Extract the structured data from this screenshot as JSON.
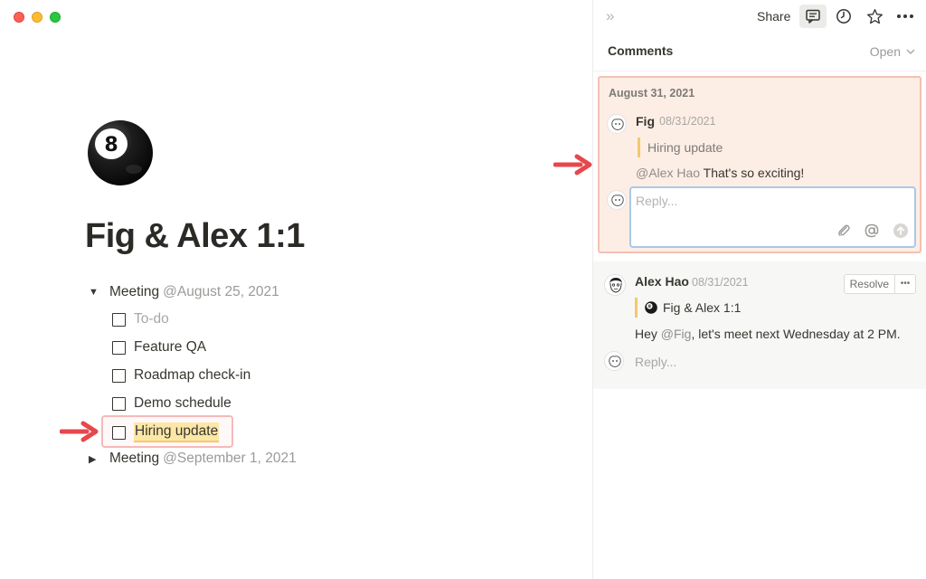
{
  "page": {
    "icon": "8-ball-icon",
    "title": "Fig & Alex 1:1"
  },
  "outline": {
    "meeting1": {
      "label": "Meeting",
      "date": "@August 25, 2021",
      "expanded": true
    },
    "todos": [
      {
        "label": "To-do",
        "placeholder": true
      },
      {
        "label": "Feature QA"
      },
      {
        "label": "Roadmap check-in"
      },
      {
        "label": "Demo schedule"
      },
      {
        "label": "Hiring update",
        "highlighted": true
      }
    ],
    "meeting2": {
      "label": "Meeting",
      "date": "@September 1, 2021",
      "expanded": false
    }
  },
  "topbar": {
    "share_label": "Share",
    "icons": [
      "collapse-icon",
      "comments-icon",
      "history-icon",
      "star-icon",
      "more-icon"
    ]
  },
  "comments": {
    "header": "Comments",
    "filter": "Open",
    "active_thread": {
      "date": "August 31, 2021",
      "author": "Fig",
      "time": "08/31/2021",
      "quote": "Hiring update",
      "mention": "@Alex Hao",
      "text": " That's so exciting!",
      "reply_placeholder": "Reply..."
    },
    "thread2": {
      "author": "Alex Hao",
      "time": "08/31/2021",
      "resolve_label": "Resolve",
      "page_link": "Fig & Alex 1:1",
      "text_before": "Hey ",
      "mention": "@Fig",
      "text_after": ", let's meet next Wednesday at 2 PM.",
      "reply_placeholder": "Reply..."
    }
  },
  "colors": {
    "highlight": "#fde7a6",
    "active_thread_bg": "#fdeee5",
    "arrow": "#e5484d",
    "quote_bar": "#f3c86b"
  }
}
